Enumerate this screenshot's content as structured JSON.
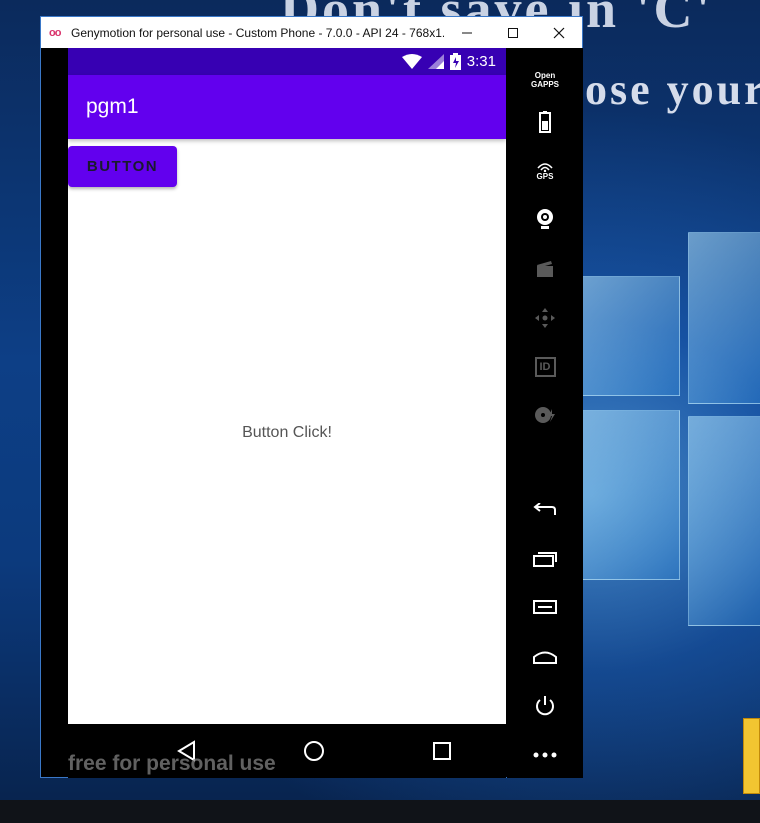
{
  "desktop": {
    "heading": "Don't save in 'C'",
    "subheading": "ose your"
  },
  "window": {
    "logo": "oo",
    "title": "Genymotion for personal use - Custom Phone - 7.0.0 - API 24 - 768x1...",
    "controls": {
      "minimize": "—",
      "maximize": "☐",
      "close": "✕"
    }
  },
  "statusbar": {
    "time": "3:31",
    "icons": [
      "wifi-icon",
      "signal-icon",
      "battery-icon"
    ]
  },
  "app": {
    "title": "pgm1",
    "button_label": "BUTTON",
    "message": "Button Click!"
  },
  "toolbar": {
    "opengapps_label": "Open GAPPS",
    "gps_label": "GPS",
    "id_label": "ID"
  },
  "watermark": "free for personal use",
  "colors": {
    "status_bar": "#3700b3",
    "app_bar": "#6200ee",
    "button": "#6200ee",
    "title_bar": "#ffffff"
  }
}
